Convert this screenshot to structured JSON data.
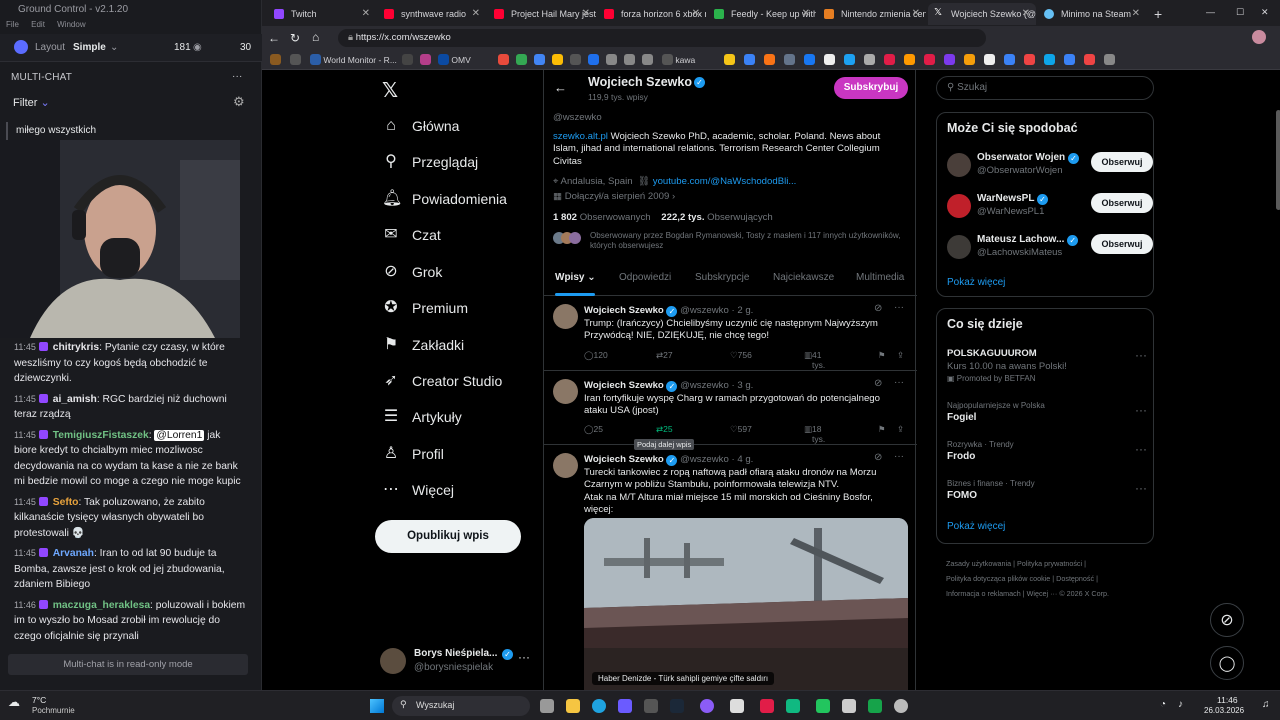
{
  "groundcontrol": {
    "title": "Ground Control - v2.1.20",
    "menu": [
      "File",
      "Edit",
      "Window"
    ],
    "layout_label": "Layout",
    "layout_value": "Simple",
    "viewers": "181",
    "count2": "30",
    "multichat_title": "MULTI-CHAT",
    "filter_label": "Filter",
    "first_message": "miłego wszystkich",
    "messages": [
      {
        "time": "11:45",
        "user": "chitrykris",
        "user_color": "#e6e6ea",
        "text": "Pytanie czy czasy, w które weszliśmy to czy kogoś będą obchodzić te dziewczynki."
      },
      {
        "time": "11:45",
        "user": "ai_amish",
        "user_color": "#e6e6ea",
        "text": "RGC bardziej niż duchowni teraz rządzą"
      },
      {
        "time": "11:45",
        "user": "TemigiuszFistaszek",
        "user_color": "#71c285",
        "mention": "@Lorren1",
        "text": "jak biore kredyt to chcialbym miec mozliwosc decydowania na co wydam ta kase a nie ze bank mi bedzie mowil co moge a czego nie moge kupic"
      },
      {
        "time": "11:45",
        "user": "Sefto",
        "user_color": "#e8a33d",
        "text": "Tak poluzowano, że zabito kilkanaście tysięcy własnych obywateli bo protestowali 💀"
      },
      {
        "time": "11:45",
        "user": "Arvanah",
        "user_color": "#6ea8ff",
        "text": "Iran to od lat 90 buduje ta Bomba, zawsze jest o krok od jej zbudowania, zdaniem Bibiego"
      },
      {
        "time": "11:46",
        "user": "maczuga_heraklesa",
        "user_color": "#71c285",
        "text": "poluzowali i bokiem im to wyszło bo Mosad zrobił im rewolucję do czego oficjalnie się przynali"
      }
    ],
    "readonly_text": "Multi-chat is in read-only mode"
  },
  "browser": {
    "tabs": [
      {
        "title": "Twitch",
        "color": "#9147ff",
        "active": false
      },
      {
        "title": "synthwave radio",
        "color": "#ff0033",
        "active": false
      },
      {
        "title": "Project Hail Mary jest",
        "color": "#ff0033",
        "active": false
      },
      {
        "title": "forza horizon 6 xbox n",
        "color": "#ff0033",
        "active": false
      },
      {
        "title": "Feedly - Keep up with",
        "color": "#2bb24c",
        "active": false
      },
      {
        "title": "Nintendo zmienia cen",
        "color": "#e67e22",
        "active": false
      },
      {
        "title": "Wojciech Szewko (@w",
        "color": "#ffffff",
        "active": true
      },
      {
        "title": "Minimo na Steam",
        "color": "#66c0f4",
        "active": false
      }
    ],
    "url": "https://x.com/wszewko",
    "bookmarks": [
      "World Monitor - R...",
      "OMV",
      "kawa"
    ]
  },
  "x": {
    "nav": [
      {
        "label": "Główna",
        "icon": "home-icon",
        "glyph": "⌂"
      },
      {
        "label": "Przeglądaj",
        "icon": "search-icon",
        "glyph": "⚲"
      },
      {
        "label": "Powiadomienia",
        "icon": "bell-icon",
        "glyph": "♫"
      },
      {
        "label": "Czat",
        "icon": "mail-icon",
        "glyph": "✉"
      },
      {
        "label": "Grok",
        "icon": "grok-icon",
        "glyph": "⊘"
      },
      {
        "label": "Premium",
        "icon": "premium-icon",
        "glyph": "✪"
      },
      {
        "label": "Zakładki",
        "icon": "bookmark-icon",
        "glyph": "⚑"
      },
      {
        "label": "Creator Studio",
        "icon": "rocket-icon",
        "glyph": "➶"
      },
      {
        "label": "Artykuły",
        "icon": "article-icon",
        "glyph": "☰"
      },
      {
        "label": "Profil",
        "icon": "profile-icon",
        "glyph": "♙"
      },
      {
        "label": "Więcej",
        "icon": "more-icon",
        "glyph": "⋯"
      }
    ],
    "post_button": "Opublikuj wpis",
    "account": {
      "name": "Borys Nieśpiela...",
      "handle": "@borysniespielak"
    },
    "profile": {
      "name": "Wojciech Szewko",
      "posts_count": "119,9 tys. wpisy",
      "subscribe": "Subskrybuj",
      "handle": "@wszewko",
      "bio_link": "szewko.alt.pl",
      "bio": "Wojciech Szewko PhD, academic, scholar. Poland. News about Islam, jihad and international relations. Terrorism Research Center Collegium Civitas",
      "location": "Andalusia, Spain",
      "website": "youtube.com/@NaWschododBli...",
      "joined": "Dołączył/a sierpień 2009",
      "following_num": "1 802",
      "following_label": "Obserwowanych",
      "followers_num": "222,2 tys.",
      "followers_label": "Obserwujących",
      "followed_by": "Obserwowany przez Bogdan Rymanowski, Tosty z masłem i 117 innych użytkowników, których obserwujesz"
    },
    "tabs": [
      "Wpisy",
      "Odpowiedzi",
      "Subskrypcje",
      "Najciekawsze",
      "Multimedia"
    ],
    "tweets": [
      {
        "name": "Wojciech Szewko",
        "handle": "@wszewko · 2 g.",
        "text": "Trump: (Irańczycy) Chcielibyśmy uczynić cię następnym Najwyższym Przywódcą! NIE, DZIĘKUJĘ, nie chcę tego!",
        "replies": "120",
        "reposts": "27",
        "likes": "756",
        "views": "41 tys."
      },
      {
        "name": "Wojciech Szewko",
        "handle": "@wszewko · 3 g.",
        "text": "Iran fortyfikuje wyspę Charg w ramach przygotowań do potencjalnego ataku USA (jpost)",
        "replies": "25",
        "reposts": "25",
        "likes": "597",
        "views": "18 tys."
      },
      {
        "name": "Wojciech Szewko",
        "handle": "@wszewko · 4 g.",
        "text": "Turecki tankowiec z ropą naftową padł ofiarą ataku dronów na Morzu Czarnym w pobliżu Stambułu, poinformowała telewizja NTV.\nAtak na M/T Altura miał miejsce 15 mil morskich od Cieśniny Bosfor, więcej:",
        "image_caption": "Haber Denizde - Türk sahipli gemiye çifte saldırı"
      }
    ],
    "tooltip": "Podaj dalej wpis",
    "search_placeholder": "Szukaj",
    "suggest_title": "Może Ci się spodobać",
    "suggestions": [
      {
        "name": "Obserwator Wojen",
        "handle": "@ObserwatorWojen",
        "color": "#4a3f3a"
      },
      {
        "name": "WarNewsPL",
        "handle": "@WarNewsPL1",
        "color": "#c0202a"
      },
      {
        "name": "Mateusz Lachow...",
        "handle": "@LachowskiMateus",
        "color": "#3d3a37"
      }
    ],
    "follow_label": "Obserwuj",
    "show_more": "Pokaż więcej",
    "trends_title": "Co się dzieje",
    "promo": {
      "title": "POLSKAGUUUROM",
      "text": "Kurs 10.00 na awans Polski!",
      "by": "Promoted by BETFAN"
    },
    "trends": [
      {
        "category": "Najpopularniejsze w Polska",
        "title": "Fogiel"
      },
      {
        "category": "Rozrywka · Trendy",
        "title": "Frodo"
      },
      {
        "category": "Biznes i finanse · Trendy",
        "title": "FOMO"
      }
    ],
    "footer": [
      "Zasady użytkowania",
      "Polityka prywatności",
      "Polityka dotycząca plików cookie",
      "Dostępność",
      "Informacja o reklamach",
      "Więcej ···",
      "© 2026 X Corp."
    ]
  },
  "taskbar": {
    "weather_temp": "7°C",
    "weather_desc": "Pochmurnie",
    "search": "Wyszukaj",
    "time": "11:46",
    "date": "26.03.2026"
  }
}
